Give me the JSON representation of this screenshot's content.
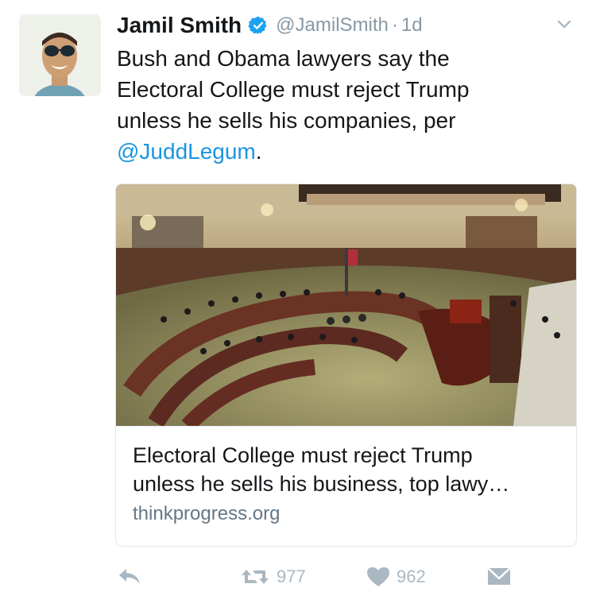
{
  "tweet": {
    "author_name": "Jamil Smith",
    "handle": "@JamilSmith",
    "separator": "·",
    "time": "1d",
    "text_lines": [
      "Bush and Obama lawyers say the",
      "Electoral College must reject Trump",
      "unless he sells his companies, per"
    ],
    "mention": "@JuddLegum",
    "text_end": "."
  },
  "card": {
    "title_lines": [
      "Electoral College must reject Trump",
      "unless he sells his business, top lawy…"
    ],
    "domain": "thinkprogress.org"
  },
  "actions": {
    "retweet_count": "977",
    "like_count": "962"
  },
  "icons": {
    "verified": "verified-badge-icon",
    "caret": "chevron-down-icon",
    "reply": "reply-icon",
    "retweet": "retweet-icon",
    "like": "heart-icon",
    "dm": "envelope-icon"
  },
  "colors": {
    "link": "#1b95e0",
    "muted": "#8899a6",
    "action": "#aab8c2",
    "text": "#14171a"
  }
}
